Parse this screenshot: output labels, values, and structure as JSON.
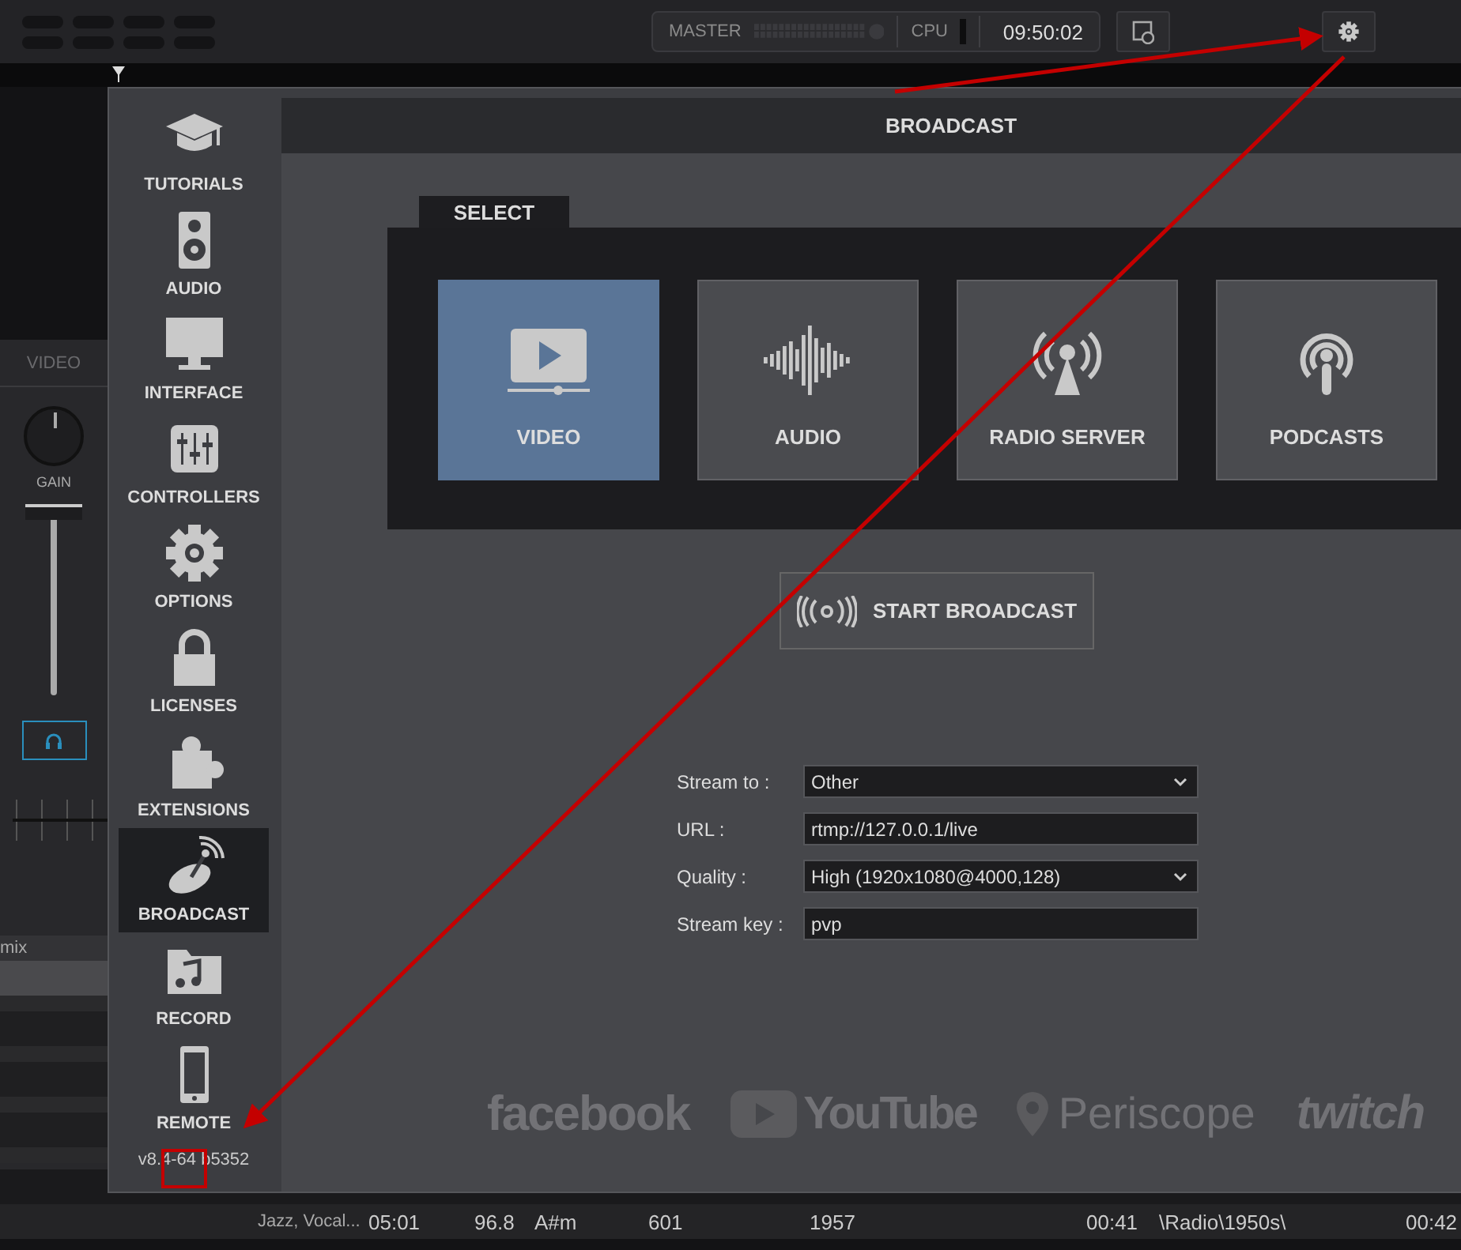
{
  "top_bar": {
    "master_label": "MASTER",
    "cpu_label": "CPU",
    "clock": "09:50:02"
  },
  "deck": {
    "tab": "VIDEO",
    "knob_label": "GAIN",
    "fader": {
      "level": 0.97
    },
    "list_header": "mix",
    "list_rows": [
      {
        "selected": true
      },
      {
        "selected": false
      },
      {
        "selected": false
      },
      {
        "selected": false
      }
    ]
  },
  "track_row": {
    "cells": [
      "Jazz, Vocal...",
      "05:01",
      "96.8",
      "A#m",
      "601",
      "1957",
      "00:41",
      "\\Radio\\1950s\\",
      "00:42"
    ]
  },
  "settings": {
    "sidebar": [
      {
        "label": "TUTORIALS",
        "selected": false
      },
      {
        "label": "AUDIO",
        "selected": false
      },
      {
        "label": "INTERFACE",
        "selected": false
      },
      {
        "label": "CONTROLLERS",
        "selected": false
      },
      {
        "label": "OPTIONS",
        "selected": false
      },
      {
        "label": "LICENSES",
        "selected": false
      },
      {
        "label": "EXTENSIONS",
        "selected": false
      },
      {
        "label": "BROADCAST",
        "selected": true
      },
      {
        "label": "RECORD",
        "selected": false
      },
      {
        "label": "REMOTE",
        "selected": false
      }
    ],
    "version": "v8.4-64 b5352",
    "title": "BROADCAST",
    "select_tab": "SELECT",
    "options": [
      {
        "label": "VIDEO",
        "selected": true
      },
      {
        "label": "AUDIO",
        "selected": false
      },
      {
        "label": "RADIO SERVER",
        "selected": false
      },
      {
        "label": "PODCASTS",
        "selected": false
      }
    ],
    "start_button": "START BROADCAST",
    "form": [
      {
        "kind": "select",
        "label": "Stream to :",
        "value": "Other"
      },
      {
        "kind": "text",
        "label": "URL :",
        "value": "rtmp://127.0.0.1/live"
      },
      {
        "kind": "select",
        "label": "Quality :",
        "value": "High (1920x1080@4000,128)"
      },
      {
        "kind": "text",
        "label": "Stream key :",
        "value": "pvp"
      }
    ],
    "services": [
      "facebook",
      "YouTube",
      "Periscope",
      "twitch"
    ]
  }
}
